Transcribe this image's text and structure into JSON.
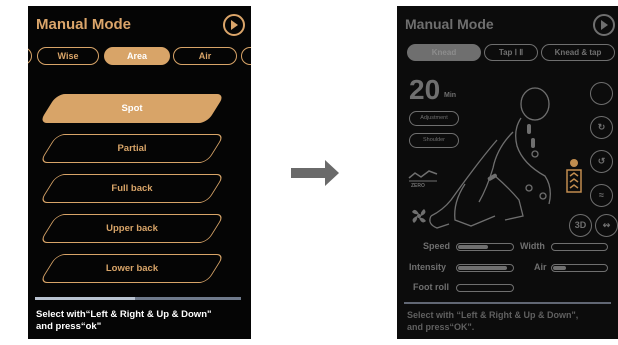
{
  "left": {
    "title": "Manual Mode",
    "tabs": [
      {
        "label": "Wise"
      },
      {
        "label": "Area",
        "active": true
      },
      {
        "label": "Air"
      }
    ],
    "areas": [
      {
        "label": "Spot",
        "selected": true
      },
      {
        "label": "Partial"
      },
      {
        "label": "Full back"
      },
      {
        "label": "Upper back"
      },
      {
        "label": "Lower back"
      }
    ],
    "hint_line1": "Select with“Left & Right & Up & Down\"",
    "hint_line2": "and press“ok\""
  },
  "right": {
    "title": "Manual Mode",
    "tabs": [
      {
        "label": "Knead",
        "active": true
      },
      {
        "label": "Tap Ⅰ Ⅱ"
      },
      {
        "label": "Knead & tap"
      }
    ],
    "timer_value": "20",
    "timer_unit": "Min",
    "adjustment_label": "Adjustment",
    "shoulder_label": "Shoulder",
    "zero_label": "ZERO",
    "threed_label": "3D",
    "speed_label": "Speed",
    "width_label": "Width",
    "intensity_label": "Intensity",
    "air_label": "Air",
    "footroll_label": "Foot roll",
    "levels": {
      "speed": 0.55,
      "width": 0.0,
      "intensity": 0.9,
      "air": 0.25,
      "foot_roll": 0.0
    },
    "hint_line1": "Select with “Left & Right & Up & Down\",",
    "hint_line2": "and press“OK\"."
  },
  "colors": {
    "accent": "#d8a468",
    "dim": "#6b6b6b",
    "background": "#050505"
  }
}
